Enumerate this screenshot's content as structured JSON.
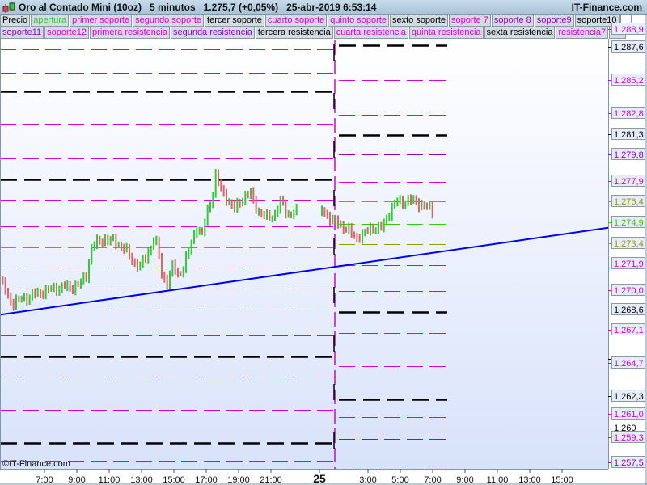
{
  "header": {
    "title": "Oro al Contado Mini (10oz)   5 minutos   1.275,7 (+0,05%)   25-abr-2019 6:53:14",
    "brand": "IT-Finance.com"
  },
  "legend": {
    "row1": [
      {
        "label": "Precio",
        "color": "#000000"
      },
      {
        "label": "apertura",
        "color": "#33cc33"
      },
      {
        "label": "primer soporte",
        "color": "#d400d4"
      },
      {
        "label": "segundo soporte",
        "color": "#d400d4"
      },
      {
        "label": "tercer soporte",
        "color": "#000000"
      },
      {
        "label": "cuarto soporte",
        "color": "#d400d4"
      },
      {
        "label": "quinto soporte",
        "color": "#d400d4"
      },
      {
        "label": "sexto soporte",
        "color": "#000000"
      },
      {
        "label": "soporte 7",
        "color": "#d400d4"
      },
      {
        "label": "soporte 8",
        "color": "#9900cc"
      },
      {
        "label": "soporte9",
        "color": "#9900cc"
      },
      {
        "label": "soporte10",
        "color": "#000000"
      }
    ],
    "row2": [
      {
        "label": "soporte11",
        "color": "#9900cc"
      },
      {
        "label": "soporte12",
        "color": "#d400d4"
      },
      {
        "label": "primera resistencia",
        "color": "#d400d4"
      },
      {
        "label": "segunda resistencia",
        "color": "#9900cc"
      },
      {
        "label": "tercera resistencia",
        "color": "#000000"
      },
      {
        "label": "cuarta resistencia",
        "color": "#d400d4"
      },
      {
        "label": "quinta resistencia",
        "color": "#d400d4"
      },
      {
        "label": "sexta resistencia",
        "color": "#000000"
      },
      {
        "label": "resistencia7",
        "color": "#d400d4"
      },
      {
        "label": "res",
        "color": "#d400d4"
      }
    ]
  },
  "copyright": "©IT-Finance.com",
  "colors": {
    "up": "#33cc33",
    "down": "#e06464",
    "trend": "#0000ee",
    "magenta": "#d400d4",
    "purple": "#9900cc",
    "olive": "#999900",
    "green": "#33cc00",
    "black": "#000000"
  },
  "chart_data": {
    "type": "candlestick",
    "title": "Oro al Contado Mini (10oz) 5 minutos",
    "ylim": [
      1256.7,
      1289.6
    ],
    "xlim_hours": [
      4.25,
      41.85
    ],
    "x_ticks": [
      {
        "label": "7:00",
        "hour": 7
      },
      {
        "label": "9:00",
        "hour": 9
      },
      {
        "label": "11:00",
        "hour": 11
      },
      {
        "label": "13:00",
        "hour": 13
      },
      {
        "label": "15:00",
        "hour": 15
      },
      {
        "label": "17:00",
        "hour": 17
      },
      {
        "label": "19:00",
        "hour": 19
      },
      {
        "label": "21:00",
        "hour": 21
      },
      {
        "label": "25",
        "hour": 24,
        "bold": true
      },
      {
        "label": "3:00",
        "hour": 27
      },
      {
        "label": "5:00",
        "hour": 29
      },
      {
        "label": "7:00",
        "hour": 31
      },
      {
        "label": "9:00",
        "hour": 33
      },
      {
        "label": "11:00",
        "hour": 35
      },
      {
        "label": "13:00",
        "hour": 37
      },
      {
        "label": "15:00",
        "hour": 39
      }
    ],
    "y_labels": [
      {
        "text": "1.288,9",
        "value": 1288.9,
        "color": "#d400d4",
        "boxed": true
      },
      {
        "text": "1.287,6",
        "value": 1287.6,
        "color": "#000000",
        "boxed": true
      },
      {
        "text": "1.285,2",
        "value": 1285.2,
        "color": "#d400d4",
        "boxed": true
      },
      {
        "text": "1.282,8",
        "value": 1282.8,
        "color": "#d400d4",
        "boxed": true
      },
      {
        "text": "1.281,3",
        "value": 1281.3,
        "color": "#000000",
        "boxed": true
      },
      {
        "text": "1.279,8",
        "value": 1279.8,
        "color": "#9900cc",
        "boxed": true
      },
      {
        "text": "1.277,9",
        "value": 1277.9,
        "color": "#d400d4",
        "boxed": true
      },
      {
        "text": "1.276,4",
        "value": 1276.4,
        "color": "#999900",
        "boxed": true
      },
      {
        "text": "1.274,9",
        "value": 1274.9,
        "color": "#33cc00",
        "boxed": true
      },
      {
        "text": "1.273,4",
        "value": 1273.4,
        "color": "#999900",
        "boxed": true
      },
      {
        "text": "1.271,9",
        "value": 1271.9,
        "color": "#d400d4",
        "boxed": true
      },
      {
        "text": "1.270,0",
        "value": 1270.0,
        "color": "#d400d4",
        "boxed": true
      },
      {
        "text": "1.268,6",
        "value": 1268.6,
        "color": "#000000",
        "boxed": true
      },
      {
        "text": "1.267,1",
        "value": 1267.1,
        "color": "#d400d4",
        "boxed": true
      },
      {
        "text": "1.265",
        "value": 1265.0,
        "color": "#000000",
        "boxed": false
      },
      {
        "text": "1.264,7",
        "value": 1264.7,
        "color": "#d400d4",
        "boxed": true
      },
      {
        "text": "1.262,3",
        "value": 1262.3,
        "color": "#000000",
        "boxed": true
      },
      {
        "text": "1.261,0",
        "value": 1261.0,
        "color": "#d400d4",
        "boxed": true
      },
      {
        "text": "1.260",
        "value": 1260.0,
        "color": "#000000",
        "boxed": false
      },
      {
        "text": "1.259,3",
        "value": 1259.3,
        "color": "#d400d4",
        "boxed": true
      },
      {
        "text": "1.257,5",
        "value": 1257.5,
        "color": "#9900cc",
        "boxed": true
      }
    ],
    "sessions": [
      {
        "start_hour": 4.25,
        "end_hour": 25.0,
        "levels": [
          {
            "price": 1287.4,
            "color": "magenta"
          },
          {
            "price": 1285.7,
            "color": "magenta"
          },
          {
            "price": 1284.4,
            "color": "black",
            "thick": true
          },
          {
            "price": 1282.0,
            "color": "magenta"
          },
          {
            "price": 1279.5,
            "color": "magenta"
          },
          {
            "price": 1278.0,
            "color": "black",
            "thick": true
          },
          {
            "price": 1276.5,
            "color": "magenta"
          },
          {
            "price": 1274.6,
            "color": "magenta"
          },
          {
            "price": 1273.1,
            "color": "olive"
          },
          {
            "price": 1271.6,
            "color": "green"
          },
          {
            "price": 1270.1,
            "color": "olive"
          },
          {
            "price": 1268.6,
            "color": "magenta"
          },
          {
            "price": 1266.7,
            "color": "magenta"
          },
          {
            "price": 1265.2,
            "color": "black",
            "thick": true
          },
          {
            "price": 1263.7,
            "color": "magenta"
          },
          {
            "price": 1261.3,
            "color": "magenta"
          },
          {
            "price": 1258.9,
            "color": "black",
            "thick": true
          },
          {
            "price": 1257.6,
            "color": "magenta"
          }
        ]
      },
      {
        "start_hour": 25.2,
        "end_hour": 31.9,
        "levels": [
          {
            "price": 1287.7,
            "color": "black",
            "thick": true
          },
          {
            "price": 1285.2,
            "color": "magenta"
          },
          {
            "price": 1282.7,
            "color": "magenta"
          },
          {
            "price": 1281.2,
            "color": "black",
            "thick": true
          },
          {
            "price": 1279.8,
            "color": "purple"
          },
          {
            "price": 1277.8,
            "color": "magenta"
          },
          {
            "price": 1276.4,
            "color": "olive"
          },
          {
            "price": 1274.8,
            "color": "green"
          },
          {
            "price": 1273.3,
            "color": "olive"
          },
          {
            "price": 1271.8,
            "color": "magenta"
          },
          {
            "price": 1269.9,
            "color": "magenta"
          },
          {
            "price": 1268.4,
            "color": "black",
            "thick": true
          },
          {
            "price": 1266.9,
            "color": "magenta"
          },
          {
            "price": 1264.5,
            "color": "magenta"
          },
          {
            "price": 1262.1,
            "color": "black",
            "thick": true
          },
          {
            "price": 1260.8,
            "color": "magenta"
          },
          {
            "price": 1259.2,
            "color": "purple"
          },
          {
            "price": 1257.3,
            "color": "purple"
          }
        ]
      }
    ],
    "session_divider_hour": 24.95,
    "price_path": [
      [
        [
          4.25,
          1270.7
        ],
        [
          5.0,
          1269.0
        ],
        [
          5.5,
          1269.3
        ],
        [
          6.25,
          1269.6
        ],
        [
          7.0,
          1269.9
        ],
        [
          8.0,
          1270.2
        ],
        [
          8.75,
          1270.2
        ],
        [
          9.25,
          1270.5
        ],
        [
          9.6,
          1271.1
        ],
        [
          9.9,
          1273.1
        ],
        [
          10.25,
          1273.4
        ],
        [
          10.75,
          1273.7
        ],
        [
          11.5,
          1273.4
        ],
        [
          12.0,
          1272.9
        ],
        [
          12.5,
          1272.0
        ],
        [
          12.9,
          1271.7
        ],
        [
          13.25,
          1272.3
        ],
        [
          13.75,
          1273.7
        ],
        [
          14.0,
          1273.1
        ],
        [
          14.25,
          1271.1
        ],
        [
          14.6,
          1270.5
        ],
        [
          14.9,
          1271.7
        ],
        [
          15.25,
          1271.1
        ],
        [
          15.6,
          1271.7
        ],
        [
          16.0,
          1273.1
        ],
        [
          16.4,
          1274.6
        ],
        [
          16.75,
          1274.0
        ],
        [
          17.1,
          1275.8
        ],
        [
          17.4,
          1277.0
        ],
        [
          17.6,
          1278.4
        ],
        [
          17.9,
          1277.2
        ],
        [
          18.25,
          1276.7
        ],
        [
          18.75,
          1275.8
        ],
        [
          19.25,
          1276.7
        ],
        [
          19.75,
          1277.0
        ],
        [
          20.0,
          1276.1
        ],
        [
          20.4,
          1275.5
        ],
        [
          20.75,
          1275.2
        ],
        [
          21.25,
          1275.5
        ],
        [
          21.6,
          1276.4
        ],
        [
          22.0,
          1275.5
        ],
        [
          22.5,
          1275.6
        ],
        [
          22.75,
          1275.6
        ]
      ],
      [
        [
          24.15,
          1275.9
        ],
        [
          24.75,
          1275.0
        ],
        [
          25.25,
          1274.8
        ],
        [
          25.75,
          1274.3
        ],
        [
          26.25,
          1273.8
        ],
        [
          26.75,
          1274.0
        ],
        [
          27.25,
          1274.6
        ],
        [
          27.75,
          1274.3
        ],
        [
          28.25,
          1275.5
        ],
        [
          28.75,
          1276.4
        ],
        [
          29.25,
          1276.4
        ],
        [
          29.75,
          1276.5
        ],
        [
          30.25,
          1276.2
        ],
        [
          30.75,
          1275.9
        ],
        [
          31.0,
          1275.7
        ]
      ]
    ],
    "trendline": [
      [
        4.25,
        1268.2
      ],
      [
        41.85,
        1274.5
      ]
    ]
  }
}
